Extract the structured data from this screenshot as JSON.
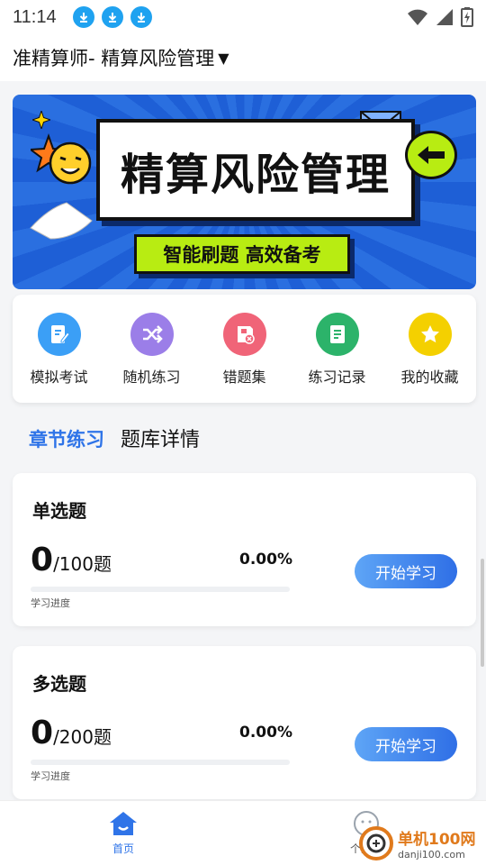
{
  "status_bar": {
    "time": "11:14",
    "download_badges": 3
  },
  "header": {
    "title": "准精算师- 精算风险管理"
  },
  "banner": {
    "title": "精算风险管理",
    "subtitle": "智能刷题  高效备考"
  },
  "actions": [
    {
      "label": "模拟考试",
      "icon": "exam-edit-icon",
      "color": "#3b9ff6"
    },
    {
      "label": "随机练习",
      "icon": "shuffle-icon",
      "color": "#9b7ee8"
    },
    {
      "label": "错题集",
      "icon": "wrong-questions-icon",
      "color": "#f06478"
    },
    {
      "label": "练习记录",
      "icon": "record-icon",
      "color": "#2cb36a"
    },
    {
      "label": "我的收藏",
      "icon": "star-icon",
      "color": "#f4d000"
    }
  ],
  "tabs": [
    {
      "label": "章节练习",
      "active": true
    },
    {
      "label": "题库详情",
      "active": false
    }
  ],
  "question_sets": [
    {
      "title": "单选题",
      "done": "0",
      "total_text": "/100题",
      "total": 100,
      "percent": "0.00%",
      "progress": 0.0,
      "caption": "学习进度",
      "button": "开始学习"
    },
    {
      "title": "多选题",
      "done": "0",
      "total_text": "/200题",
      "total": 200,
      "percent": "0.00%",
      "progress": 0.0,
      "caption": "学习进度",
      "button": "开始学习"
    }
  ],
  "bottom_nav": {
    "home_label": "首页",
    "me_label": "个人中"
  },
  "watermark": {
    "brand": "单机100网",
    "url": "danji100.com"
  },
  "colors": {
    "accent": "#2f74e8",
    "banner_blue": "#2a6fe0",
    "banner_green": "#b8ec12"
  }
}
